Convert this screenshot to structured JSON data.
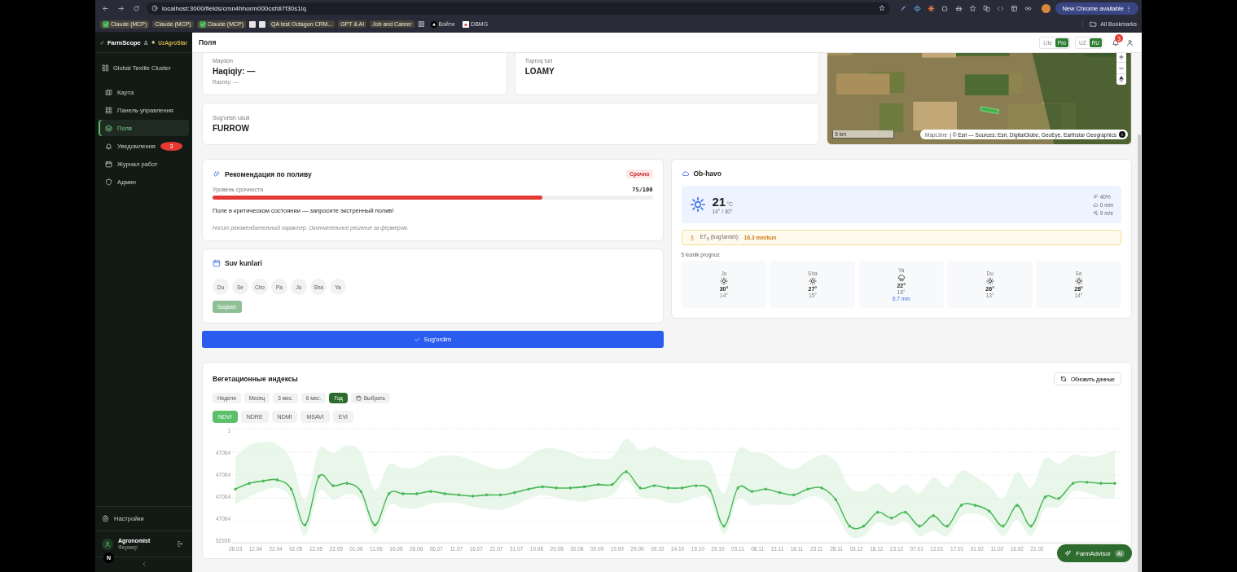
{
  "browser": {
    "url": "localhost:3000/fields/cmn4hhorm000csfdi7f30s1lq",
    "update_button": "New Chrome available",
    "update_menu": "⋮",
    "all_bookmarks": "All Bookmarks",
    "bookmarks": [
      {
        "kind": "check",
        "label": "Claude (MCP)"
      },
      {
        "kind": "plain",
        "label": "Claude (MCP)"
      },
      {
        "kind": "check",
        "label": "Claude (MCP)"
      },
      {
        "kind": "page"
      },
      {
        "kind": "page"
      },
      {
        "kind": "plain",
        "label": "QA test Octagon CRM..."
      },
      {
        "kind": "plain",
        "label": "GPT & AI"
      },
      {
        "kind": "plain",
        "label": "Job and Career"
      },
      {
        "kind": "apps"
      },
      {
        "kind": "triangle",
        "label": "Войти"
      },
      {
        "kind": "logo",
        "label": "DBMG"
      }
    ]
  },
  "sidebar": {
    "brand": "FarmScope",
    "ampersand": "&",
    "partner": "UzAgroStar",
    "organization": "Global Textile Cluster",
    "items": [
      {
        "label": "Карта",
        "selected": false
      },
      {
        "label": "Панель управления",
        "selected": false
      },
      {
        "label": "Поля",
        "selected": true
      },
      {
        "label": "Уведомления",
        "selected": false,
        "badge": "3"
      },
      {
        "label": "Журнал работ",
        "selected": false
      },
      {
        "label": "Админ",
        "selected": false
      }
    ],
    "settings": "Настройки",
    "user": {
      "name": "Agronomist",
      "role": "Фермер"
    },
    "dev_badge": "N"
  },
  "header": {
    "title": "Поля",
    "modes": [
      {
        "label": "Lite",
        "selected": false
      },
      {
        "label": "Pro",
        "selected": true
      }
    ],
    "languages": [
      {
        "label": "UZ",
        "selected": false
      },
      {
        "label": "RU",
        "selected": true
      }
    ],
    "notification_count": "3"
  },
  "field_info": {
    "area": {
      "label": "Maydon",
      "value": "Haqiqiy: —",
      "note": "Rasmiy: —"
    },
    "soil": {
      "label": "Tuproq turi",
      "value": "LOAMY"
    },
    "irrigation_method": {
      "label": "Sug'orish usuli",
      "value": "FURROW"
    }
  },
  "map": {
    "scale": "5 km",
    "attribution_link": "MapLibre",
    "attribution": "| © Esri — Sources: Esri, DigitalGlobe, GeoEye, Earthstar Geographics"
  },
  "recommendation": {
    "title": "Рекомендация по поливу",
    "badge": "Срочно",
    "urgency_label": "Уровень срочности",
    "urgency_value": "75/100",
    "level": 0.75,
    "message": "Поле в критическом состоянии — запросите экстренный полив!",
    "note": "Носит рекомендательный характер. Окончательное решение за фермером."
  },
  "water_days": {
    "title": "Suv kunlari",
    "days": [
      {
        "label": "Du",
        "selected": false
      },
      {
        "label": "Se",
        "selected": false
      },
      {
        "label": "Cho",
        "selected": false
      },
      {
        "label": "Pa",
        "selected": false
      },
      {
        "label": "Ju",
        "selected": false
      },
      {
        "label": "Sha",
        "selected": false
      },
      {
        "label": "Ya",
        "selected": false
      }
    ],
    "save_button": {
      "label": "Saqlash",
      "disabled": true
    }
  },
  "watered_button": "Sug'ordim",
  "weather": {
    "title": "Ob-havo",
    "temperature": "21",
    "unit": "°C",
    "range": "14° / 30°",
    "humidity": "40%",
    "precipitation": "0 mm",
    "wind": "9 m/s",
    "et_label": "ET$_{0}$ (bug'lanish):",
    "et_value": "16.3 mm/kun",
    "forecast_title": "5 kunlik prognoz",
    "forecast": [
      {
        "day": "Ju",
        "kind": "sun",
        "high": "30°",
        "low": "14°"
      },
      {
        "day": "Sha",
        "kind": "sun",
        "high": "27°",
        "low": "15°"
      },
      {
        "day": "Ya",
        "kind": "rain",
        "high": "22°",
        "low": "16°",
        "precipitation": "6.7 mm"
      },
      {
        "day": "Du",
        "kind": "sun",
        "high": "26°",
        "low": "13°"
      },
      {
        "day": "Se",
        "kind": "sun",
        "high": "28°",
        "low": "14°"
      }
    ]
  },
  "vegetation": {
    "title": "Вегетационные индексы",
    "refresh_button": "Обновить данные",
    "periods": [
      {
        "label": "Неделя",
        "selected": false
      },
      {
        "label": "Месяц",
        "selected": false
      },
      {
        "label": "3 мес.",
        "selected": false
      },
      {
        "label": "6 мес.",
        "selected": false
      },
      {
        "label": "Год",
        "selected": true
      }
    ],
    "custom_period": "Выбрать",
    "indices": [
      {
        "label": "NDVI",
        "selected": true
      },
      {
        "label": "NDRE",
        "selected": false
      },
      {
        "label": "NDMI",
        "selected": false
      },
      {
        "label": "MSAVI",
        "selected": false
      },
      {
        "label": "EVI",
        "selected": false
      }
    ],
    "chart": {
      "y_labels": [
        "1",
        "47064",
        "47064",
        "47064",
        "47064",
        "52936"
      ],
      "x_labels": [
        "28.03",
        "12.04",
        "22.04",
        "02.05",
        "12.05",
        "22.05",
        "01.06",
        "11.06",
        "16.06",
        "26.06",
        "06.07",
        "11.07",
        "16.07",
        "21.07",
        "31.07",
        "10.08",
        "20.08",
        "30.08",
        "09.09",
        "19.09",
        "29.09",
        "09.10",
        "14.10",
        "19.10",
        "29.10",
        "03.11",
        "08.11",
        "13.11",
        "18.11",
        "23.11",
        "28.11",
        "03.12",
        "18.12",
        "23.12",
        "07.01",
        "12.01",
        "17.01",
        "01.02",
        "11.02",
        "16.02",
        "21.02"
      ]
    }
  },
  "advisor_button": {
    "label": "FarmAdvisor",
    "badge": "AI"
  }
}
